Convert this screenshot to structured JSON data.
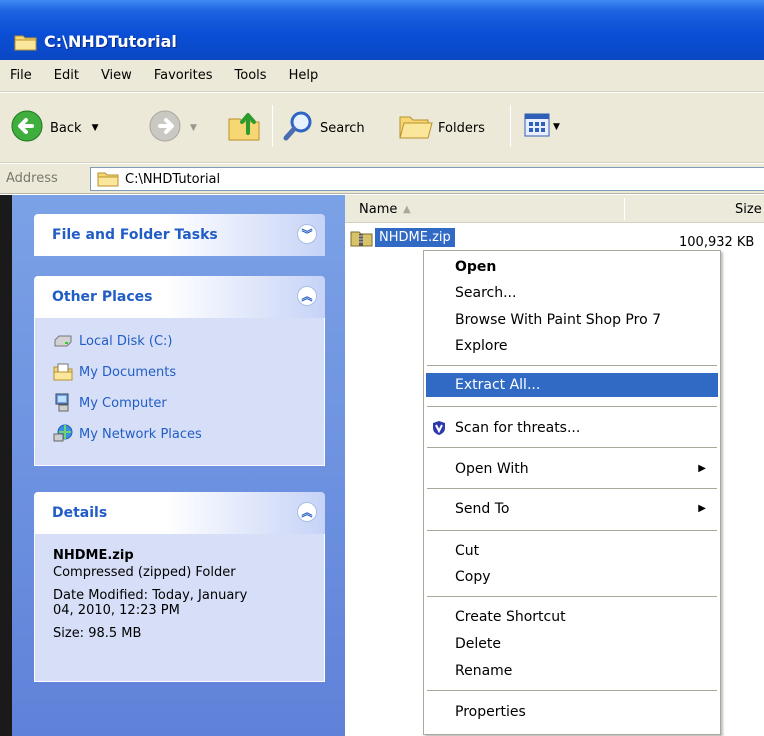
{
  "window": {
    "title": "C:\\NHDTutorial"
  },
  "menu": [
    "File",
    "Edit",
    "View",
    "Favorites",
    "Tools",
    "Help"
  ],
  "toolbar": {
    "back": "Back",
    "search": "Search",
    "folders": "Folders"
  },
  "address": {
    "label": "Address",
    "value": "C:\\NHDTutorial"
  },
  "tasks": {
    "file_folder": {
      "title": "File and Folder Tasks"
    },
    "other_places": {
      "title": "Other Places",
      "items": [
        {
          "label": "Local Disk (C:)",
          "icon": "drive-icon"
        },
        {
          "label": "My Documents",
          "icon": "documents-folder-icon"
        },
        {
          "label": "My Computer",
          "icon": "computer-icon"
        },
        {
          "label": "My Network Places",
          "icon": "network-icon"
        }
      ]
    },
    "details": {
      "title": "Details",
      "name": "NHDME.zip",
      "type": "Compressed (zipped) Folder",
      "modified_line1": "Date Modified: Today, January",
      "modified_line2": "04, 2010, 12:23 PM",
      "size": "Size: 98.5 MB"
    }
  },
  "list": {
    "columns": {
      "name": "Name",
      "size": "Size"
    },
    "file": {
      "name": "NHDME.zip",
      "size": "100,932 KB"
    }
  },
  "context_menu": {
    "open": "Open",
    "search": "Search...",
    "browse": "Browse With Paint Shop Pro 7",
    "explore": "Explore",
    "extract": "Extract All...",
    "scan": "Scan for threats...",
    "open_with": "Open With",
    "send_to": "Send To",
    "cut": "Cut",
    "copy": "Copy",
    "create_shortcut": "Create Shortcut",
    "delete": "Delete",
    "rename": "Rename",
    "properties": "Properties"
  },
  "colors": {
    "selection": "#316ac5",
    "titlebar": "#0a4fd6",
    "taskpane_link": "#215dc6"
  }
}
